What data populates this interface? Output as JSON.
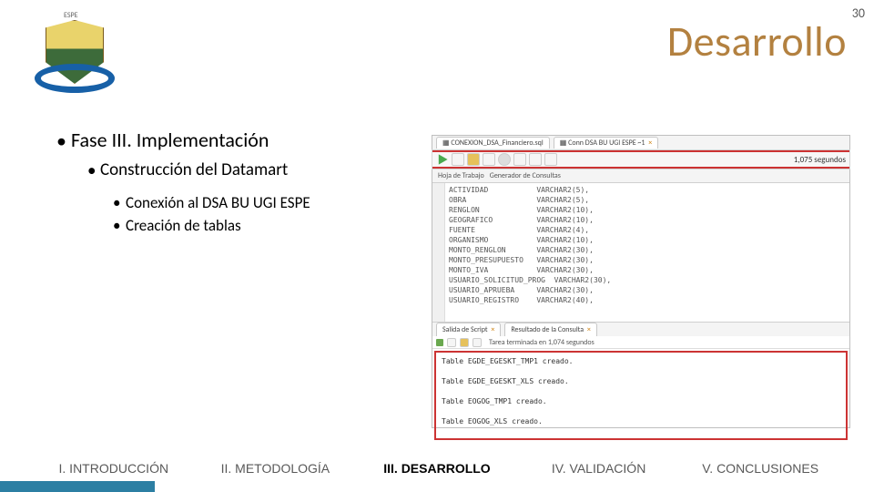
{
  "page_number": "30",
  "title": "Desarrollo",
  "logo_top_text": "ESPE",
  "bullets": {
    "l1": "Fase III. Implementación",
    "l2": "Construcción del Datamart",
    "l3a": "Conexión al DSA BU UGI ESPE",
    "l3b": "Creación de tablas"
  },
  "screenshot": {
    "tab1": "CONEXION_DSA_Financiero.sql",
    "tab2": "Conn DSA BU UGI ESPE ~1",
    "toolbar_time": "1,075  segundos",
    "subtab1": "Hoja de Trabajo",
    "subtab2": "Generador de Consultas",
    "code": [
      "ACTIVIDAD           VARCHAR2(5),",
      "OBRA                VARCHAR2(5),",
      "RENGLON             VARCHAR2(10),",
      "GEOGRAFICO          VARCHAR2(10),",
      "FUENTE              VARCHAR2(4),",
      "ORGANISMO           VARCHAR2(10),",
      "MONTO_RENGLON       VARCHAR2(30),",
      "MONTO_PRESUPUESTO   VARCHAR2(30),",
      "MONTO_IVA           VARCHAR2(30),",
      "USUARIO_SOLICITUD_PROG  VARCHAR2(30),",
      "USUARIO_APRUEBA     VARCHAR2(30),",
      "USUARIO_REGISTRO    VARCHAR2(40),"
    ],
    "res_tab1": "Salida de Script",
    "res_tab2": "Resultado de la Consulta",
    "res_bar": "Tarea terminada en 1,074 segundos",
    "output": [
      "Table EGDE_EGESKT_TMP1 creado.",
      "Table EGDE_EGESKT_XLS creado.",
      "Table EOGOG_TMP1 creado.",
      "Table EOGOG_XLS creado."
    ]
  },
  "footer": {
    "i": "I. INTRODUCCIÓN",
    "ii": "II. METODOLOGÍA",
    "iii": "III. DESARROLLO",
    "iv": "IV. VALIDACIÓN",
    "v": "V. CONCLUSIONES"
  }
}
